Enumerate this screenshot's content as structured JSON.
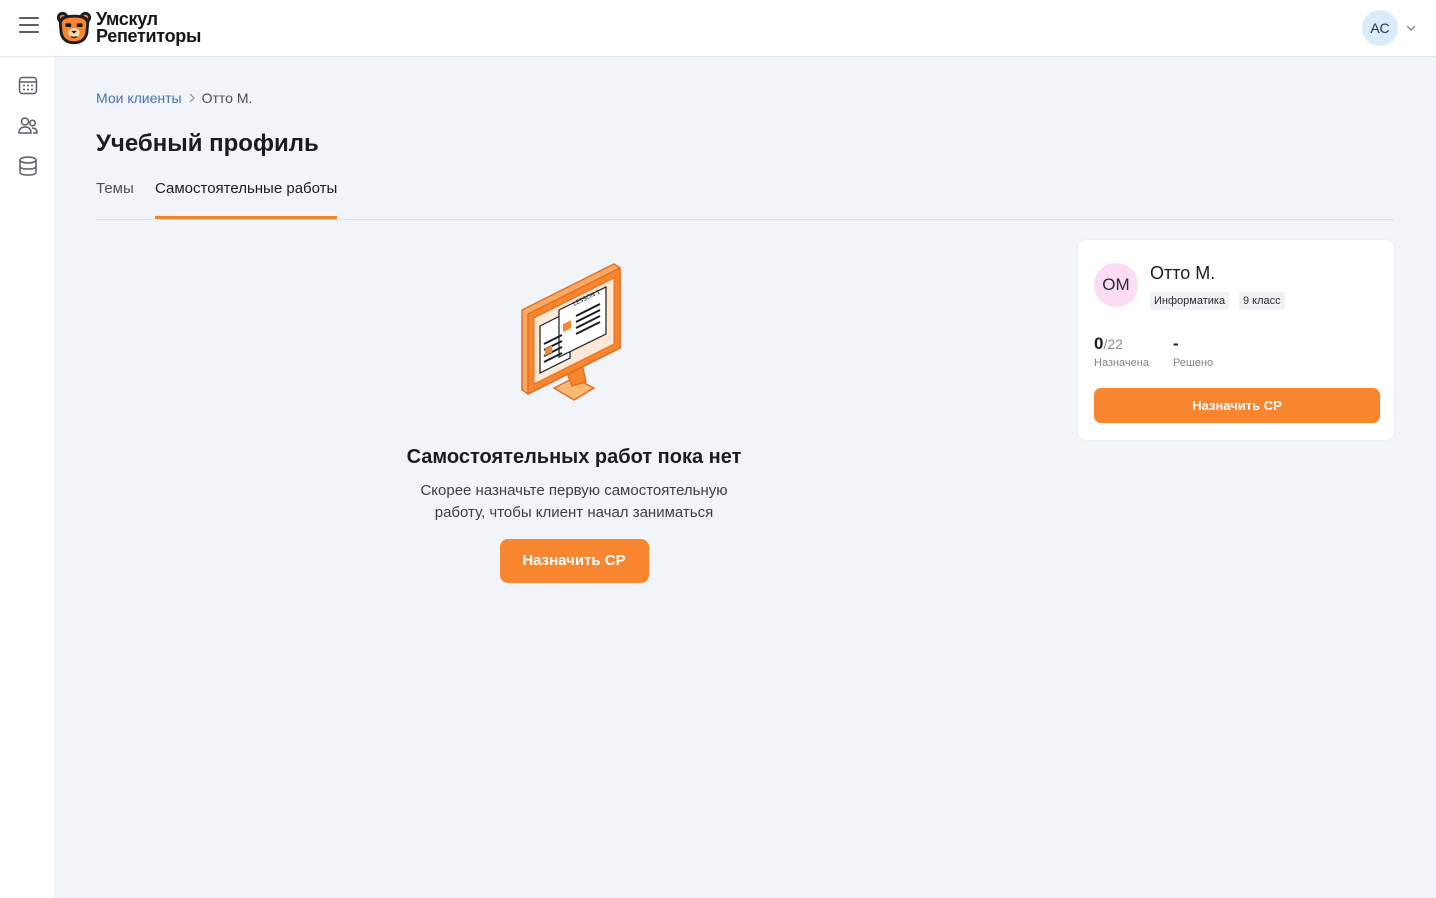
{
  "header": {
    "logo_line1": "Умскул",
    "logo_line2": "Репетиторы",
    "user_initials": "АС"
  },
  "sidebar": {
    "items": [
      {
        "icon": "calendar-icon"
      },
      {
        "icon": "users-icon"
      },
      {
        "icon": "database-icon"
      }
    ]
  },
  "breadcrumb": {
    "parent": "Мои клиенты",
    "current": "Отто М."
  },
  "page": {
    "title": "Учебный профиль"
  },
  "tabs": [
    {
      "label": "Темы",
      "active": false
    },
    {
      "label": "Самостоятельные работы",
      "active": true
    }
  ],
  "empty_state": {
    "title": "Самостоятельных работ пока нет",
    "description": "Скорее назначьте первую самостоятельную работу, чтобы клиент начал заниматься",
    "button_label": "Назначить СР",
    "illustration_text": "LESSON 1"
  },
  "client_card": {
    "initials": "ОМ",
    "name": "Отто М.",
    "subject": "Информатика",
    "grade": "9 класс",
    "assigned_count": "0",
    "assigned_total": "/22",
    "assigned_label": "Назначена",
    "solved_value": "-",
    "solved_label": "Решено",
    "button_label": "Назначить СР"
  },
  "colors": {
    "accent": "#f7862e",
    "link": "#4a6fb5",
    "background": "#f1f4f9"
  }
}
